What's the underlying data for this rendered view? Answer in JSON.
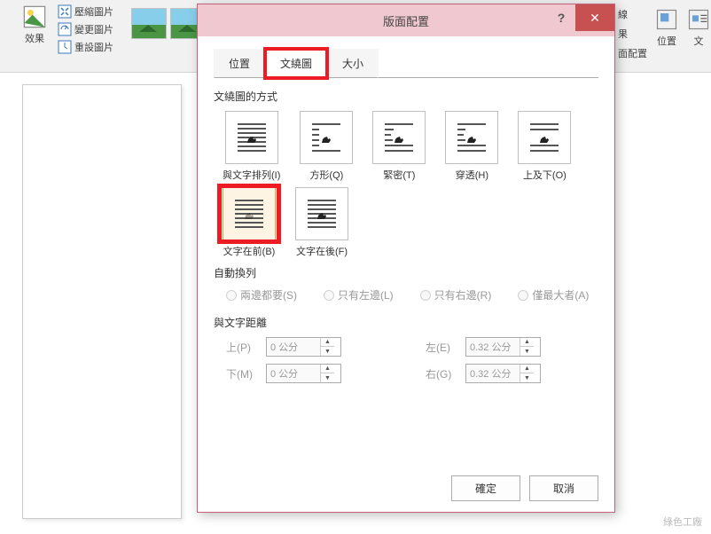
{
  "ribbon": {
    "left_group_label": "效果",
    "compress": "壓縮圖片",
    "change": "變更圖片",
    "reset": "重設圖片",
    "right": {
      "border": "線",
      "effect": "果",
      "layout_label": "面配置",
      "position": "位置",
      "wrap": "文"
    }
  },
  "dialog": {
    "title": "版面配置",
    "tabs": {
      "position": "位置",
      "wrap": "文繞圖",
      "size": "大小"
    },
    "wrap_section_label": "文繞圖的方式",
    "wrap_options": {
      "inline": "與文字排列(I)",
      "square": "方形(Q)",
      "tight": "緊密(T)",
      "through": "穿透(H)",
      "topbottom": "上及下(O)",
      "behind": "文字在前(B)",
      "infront": "文字在後(F)"
    },
    "autowrap_label": "自動換列",
    "autowrap": {
      "both": "兩邊都要(S)",
      "left": "只有左邊(L)",
      "right": "只有右邊(R)",
      "largest": "僅最大者(A)"
    },
    "distance_label": "與文字距離",
    "distance": {
      "top_label": "上(P)",
      "bottom_label": "下(M)",
      "left_label": "左(E)",
      "right_label": "右(G)",
      "top_value": "0 公分",
      "bottom_value": "0 公分",
      "left_value": "0.32 公分",
      "right_value": "0.32 公分"
    },
    "buttons": {
      "ok": "確定",
      "cancel": "取消"
    }
  },
  "watermark": "綠色工廠"
}
